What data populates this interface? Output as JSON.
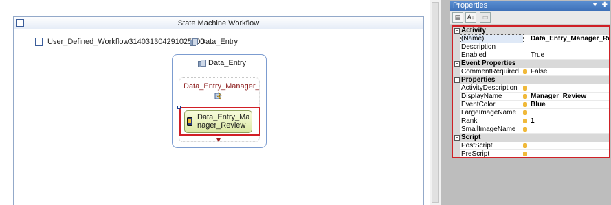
{
  "designer": {
    "title": "State Machine Workflow",
    "workflow_name": "User_Defined_Workflow3140313042910256​00",
    "colon": ":",
    "initial_state": "Data_Entry",
    "state": {
      "title": "Data_Entry",
      "event_title": "Data_Entry_Manager_Re...",
      "activity_label": "Data_Entry_Manager_Review"
    }
  },
  "properties": {
    "title": "Properties",
    "toolbar": [
      "categorized",
      "alphabetical",
      "property-pages"
    ],
    "categories": [
      {
        "name": "Activity",
        "rows": [
          {
            "name": "(Name)",
            "value": "Data_Entry_Manager_Review",
            "bold": true,
            "bind": false
          },
          {
            "name": "Description",
            "value": "",
            "bold": false,
            "bind": false
          },
          {
            "name": "Enabled",
            "value": "True",
            "bold": false,
            "bind": false
          }
        ]
      },
      {
        "name": "Event Properties",
        "rows": [
          {
            "name": "CommentRequired",
            "value": "False",
            "bold": false,
            "bind": true
          }
        ]
      },
      {
        "name": "Properties",
        "rows": [
          {
            "name": "ActivityDescription",
            "value": "",
            "bold": false,
            "bind": true
          },
          {
            "name": "DisplayName",
            "value": "Manager_Review",
            "bold": true,
            "bind": true
          },
          {
            "name": "EventColor",
            "value": "Blue",
            "bold": true,
            "bind": true
          },
          {
            "name": "LargeImageName",
            "value": "",
            "bold": false,
            "bind": true
          },
          {
            "name": "Rank",
            "value": "1",
            "bold": true,
            "bind": true
          },
          {
            "name": "SmallImageName",
            "value": "",
            "bold": false,
            "bind": true
          }
        ]
      },
      {
        "name": "Script",
        "rows": [
          {
            "name": "PostScript",
            "value": "",
            "bold": false,
            "bind": true
          },
          {
            "name": "PreScript",
            "value": "",
            "bold": false,
            "bind": true
          }
        ]
      }
    ]
  },
  "colors": {
    "selection_border": "#d11f26",
    "titlebar": "#4a80c6",
    "activity_fill": "#e6efb8"
  }
}
